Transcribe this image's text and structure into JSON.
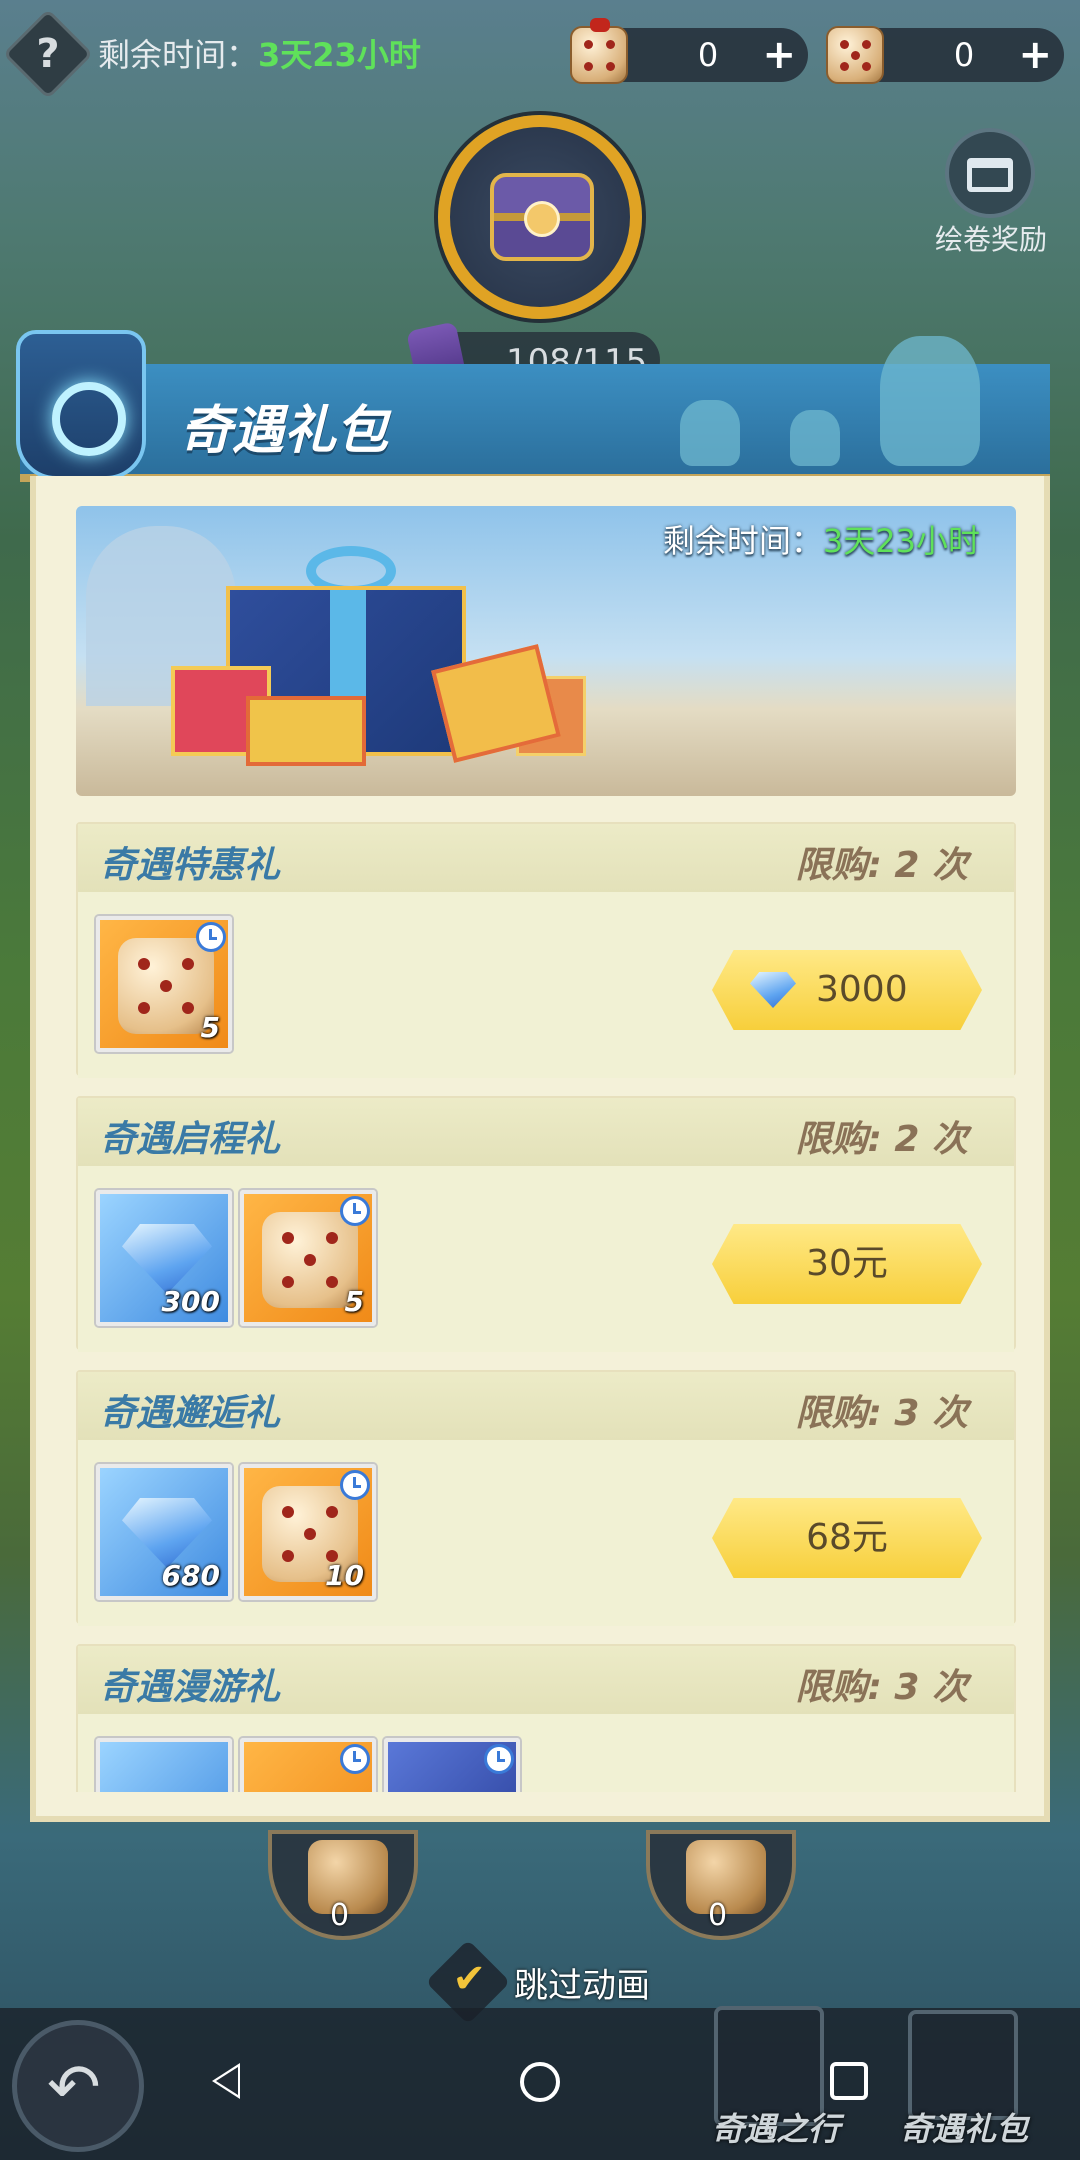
{
  "hud": {
    "remain_label": "剩余时间：",
    "remain_value": "3天23小时",
    "resource_1": "0",
    "resource_2": "0",
    "progress": "108/115",
    "album_label": "绘卷奖励"
  },
  "panel": {
    "title": "奇遇礼包",
    "banner_remain_label": "剩余时间：",
    "banner_remain_value": "3天23小时"
  },
  "packs": [
    {
      "name": "奇遇特惠礼",
      "limit": "限购: 2 次",
      "items": [
        {
          "type": "dice",
          "qty": "5",
          "timed": true
        }
      ],
      "price": "3000",
      "price_icon": "gem-icon"
    },
    {
      "name": "奇遇启程礼",
      "limit": "限购: 2 次",
      "items": [
        {
          "type": "gem",
          "qty": "300"
        },
        {
          "type": "dice",
          "qty": "5",
          "timed": true
        }
      ],
      "price": "30元"
    },
    {
      "name": "奇遇邂逅礼",
      "limit": "限购: 3 次",
      "items": [
        {
          "type": "gem",
          "qty": "680"
        },
        {
          "type": "dice",
          "qty": "10",
          "timed": true
        }
      ],
      "price": "68元"
    },
    {
      "name": "奇遇漫游礼",
      "limit": "限购: 3 次",
      "items": [],
      "price": ""
    }
  ],
  "board": {
    "left_dice_count": "0",
    "right_dice_count": "0",
    "skip_animation_label": "跳过动画"
  },
  "tabs": {
    "journey": "奇遇之行",
    "gift": "奇遇礼包"
  },
  "colors": {
    "accent_green": "#5fe15a",
    "title_blue": "#3a7aa6",
    "price_yellow": "#f7cf3b",
    "header_blue": "#2b6f9c"
  }
}
